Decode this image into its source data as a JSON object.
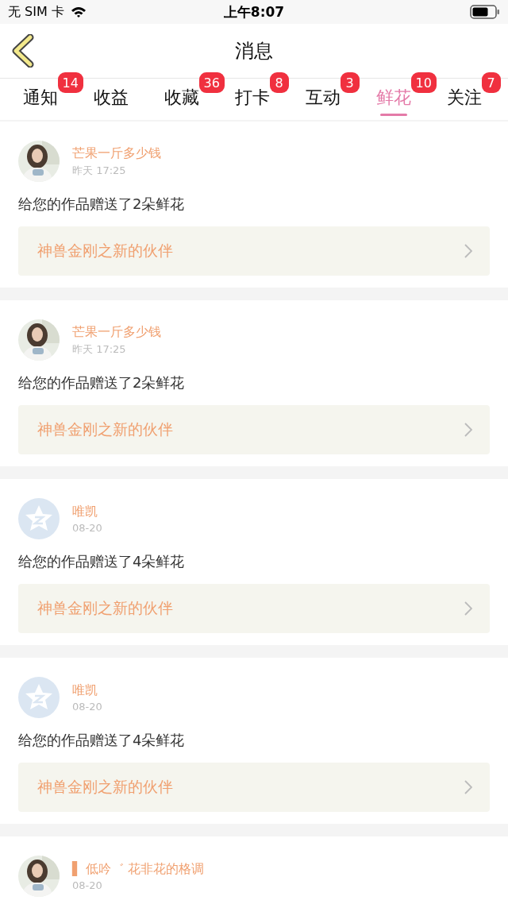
{
  "status_bar": {
    "carrier": "无 SIM 卡",
    "time": "上午8:07"
  },
  "nav": {
    "title": "消息"
  },
  "tabs": [
    {
      "label": "通知",
      "badge": "14",
      "selected": false
    },
    {
      "label": "收益",
      "selected": false
    },
    {
      "label": "收藏",
      "badge": "36",
      "selected": false
    },
    {
      "label": "打卡",
      "badge": "8",
      "selected": false
    },
    {
      "label": "互动",
      "badge": "3",
      "selected": false
    },
    {
      "label": "鲜花",
      "badge": "10",
      "selected": true
    },
    {
      "label": "关注",
      "badge": "7",
      "selected": false
    }
  ],
  "messages": [
    {
      "kind": "picture",
      "name": "芒果一斤多少钱",
      "time": "昨天 17:25",
      "text": "给您的作品赠送了2朵鲜花",
      "work": "神兽金刚之新的伙伴"
    },
    {
      "kind": "picture",
      "name": "芒果一斤多少钱",
      "time": "昨天 17:25",
      "text": "给您的作品赠送了2朵鲜花",
      "work": "神兽金刚之新的伙伴"
    },
    {
      "kind": "default",
      "name": "唯凯",
      "time": "08-20",
      "text": "给您的作品赠送了4朵鲜花",
      "work": "神兽金刚之新的伙伴"
    },
    {
      "kind": "default",
      "name": "唯凯",
      "time": "08-20",
      "text": "给您的作品赠送了4朵鲜花",
      "work": "神兽金刚之新的伙伴"
    },
    {
      "kind": "picture",
      "name": "▌ 低吟゛ 花非花的格调",
      "time": "08-20"
    }
  ]
}
